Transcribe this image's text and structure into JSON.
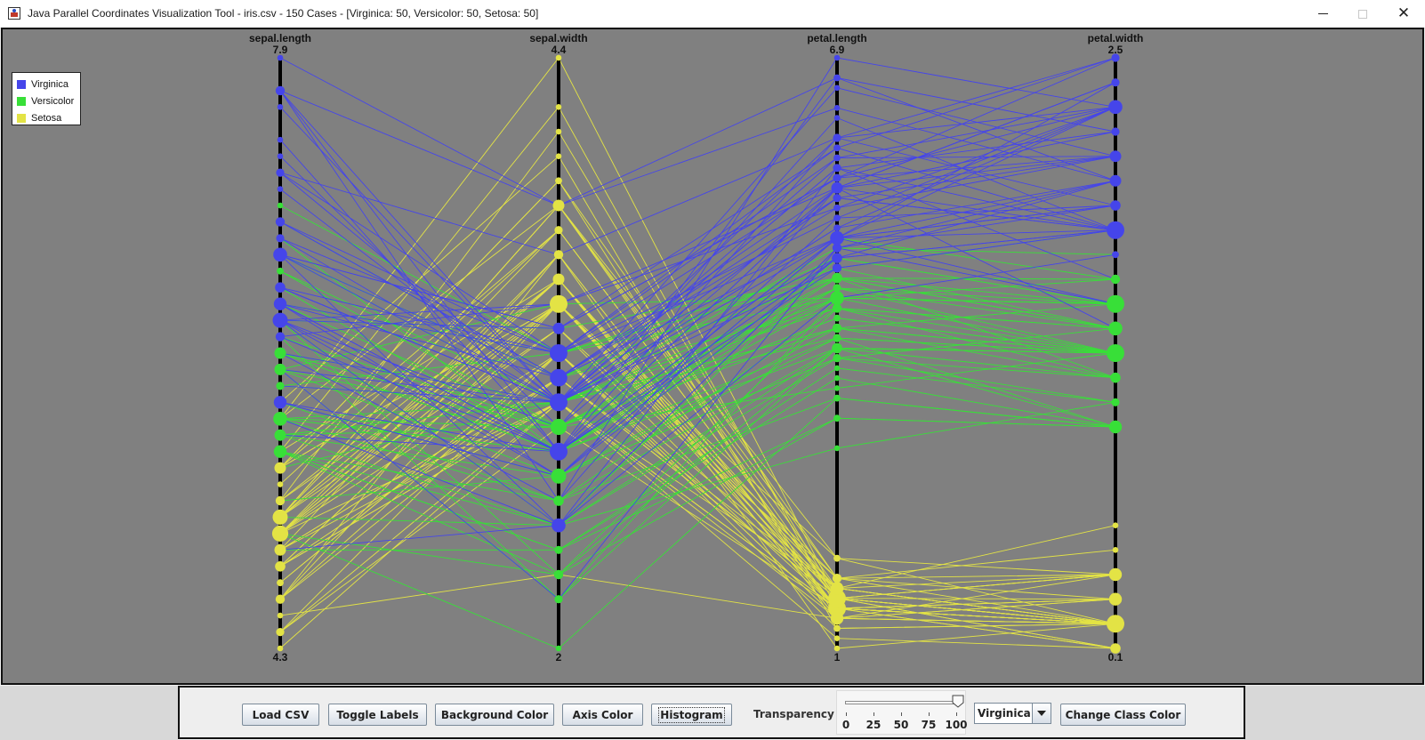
{
  "window": {
    "title": "Java Parallel Coordinates Visualization Tool - iris.csv - 150 Cases - [Virginica: 50, Versicolor: 50, Setosa: 50]"
  },
  "legend": {
    "items": [
      {
        "label": "Virginica",
        "color": "#4545ea"
      },
      {
        "label": "Versicolor",
        "color": "#38df38"
      },
      {
        "label": "Setosa",
        "color": "#e3e345"
      }
    ]
  },
  "controls": {
    "load_csv": "Load CSV",
    "toggle_labels": "Toggle Labels",
    "background_color": "Background Color",
    "axis_color": "Axis Color",
    "histogram": "Histogram",
    "transparency_label": "Transparency",
    "slider": {
      "value": 100,
      "ticks": [
        "0",
        "25",
        "50",
        "75",
        "100"
      ]
    },
    "class_select": "Virginica",
    "change_class_color": "Change Class Color"
  },
  "chart_data": {
    "type": "parallel-coordinates",
    "background": "#808080",
    "axes": [
      {
        "name": "sepal.length",
        "max": "7.9",
        "min": "4.3"
      },
      {
        "name": "sepal.width",
        "max": "4.4",
        "min": "2"
      },
      {
        "name": "petal.length",
        "max": "6.9",
        "min": "1"
      },
      {
        "name": "petal.width",
        "max": "2.5",
        "min": "0.1"
      }
    ],
    "classes": [
      {
        "name": "Virginica",
        "color": "#4545ea"
      },
      {
        "name": "Versicolor",
        "color": "#38df38"
      },
      {
        "name": "Setosa",
        "color": "#e3e345"
      }
    ],
    "rows": [
      [
        5.1,
        3.5,
        1.4,
        0.2,
        2
      ],
      [
        4.9,
        3.0,
        1.4,
        0.2,
        2
      ],
      [
        4.7,
        3.2,
        1.3,
        0.2,
        2
      ],
      [
        4.6,
        3.1,
        1.5,
        0.2,
        2
      ],
      [
        5.0,
        3.6,
        1.4,
        0.2,
        2
      ],
      [
        5.4,
        3.9,
        1.7,
        0.4,
        2
      ],
      [
        4.6,
        3.4,
        1.4,
        0.3,
        2
      ],
      [
        5.0,
        3.4,
        1.5,
        0.2,
        2
      ],
      [
        4.4,
        2.9,
        1.4,
        0.2,
        2
      ],
      [
        4.9,
        3.1,
        1.5,
        0.1,
        2
      ],
      [
        5.4,
        3.7,
        1.5,
        0.2,
        2
      ],
      [
        4.8,
        3.4,
        1.6,
        0.2,
        2
      ],
      [
        4.8,
        3.0,
        1.4,
        0.1,
        2
      ],
      [
        4.3,
        3.0,
        1.1,
        0.1,
        2
      ],
      [
        5.8,
        4.0,
        1.2,
        0.2,
        2
      ],
      [
        5.7,
        4.4,
        1.5,
        0.4,
        2
      ],
      [
        5.4,
        3.9,
        1.3,
        0.4,
        2
      ],
      [
        5.1,
        3.5,
        1.4,
        0.3,
        2
      ],
      [
        5.7,
        3.8,
        1.7,
        0.3,
        2
      ],
      [
        5.1,
        3.8,
        1.5,
        0.3,
        2
      ],
      [
        5.4,
        3.4,
        1.7,
        0.2,
        2
      ],
      [
        5.1,
        3.7,
        1.5,
        0.4,
        2
      ],
      [
        4.6,
        3.6,
        1.0,
        0.2,
        2
      ],
      [
        5.1,
        3.3,
        1.7,
        0.5,
        2
      ],
      [
        4.8,
        3.4,
        1.9,
        0.2,
        2
      ],
      [
        5.0,
        3.0,
        1.6,
        0.2,
        2
      ],
      [
        5.0,
        3.4,
        1.6,
        0.4,
        2
      ],
      [
        5.2,
        3.5,
        1.5,
        0.2,
        2
      ],
      [
        5.2,
        3.4,
        1.4,
        0.2,
        2
      ],
      [
        4.7,
        3.2,
        1.6,
        0.2,
        2
      ],
      [
        4.8,
        3.1,
        1.6,
        0.2,
        2
      ],
      [
        5.4,
        3.4,
        1.5,
        0.4,
        2
      ],
      [
        5.2,
        4.1,
        1.5,
        0.1,
        2
      ],
      [
        5.5,
        4.2,
        1.4,
        0.2,
        2
      ],
      [
        4.9,
        3.1,
        1.5,
        0.2,
        2
      ],
      [
        5.0,
        3.2,
        1.2,
        0.2,
        2
      ],
      [
        5.5,
        3.5,
        1.3,
        0.2,
        2
      ],
      [
        4.9,
        3.6,
        1.4,
        0.1,
        2
      ],
      [
        4.4,
        3.0,
        1.3,
        0.2,
        2
      ],
      [
        5.1,
        3.4,
        1.5,
        0.2,
        2
      ],
      [
        5.0,
        3.5,
        1.3,
        0.3,
        2
      ],
      [
        4.5,
        2.3,
        1.3,
        0.3,
        2
      ],
      [
        4.4,
        3.2,
        1.3,
        0.2,
        2
      ],
      [
        5.0,
        3.5,
        1.6,
        0.6,
        2
      ],
      [
        5.1,
        3.8,
        1.9,
        0.4,
        2
      ],
      [
        4.8,
        3.0,
        1.4,
        0.3,
        2
      ],
      [
        5.1,
        3.8,
        1.6,
        0.2,
        2
      ],
      [
        4.6,
        3.2,
        1.4,
        0.2,
        2
      ],
      [
        5.3,
        3.7,
        1.5,
        0.2,
        2
      ],
      [
        5.0,
        3.3,
        1.4,
        0.2,
        2
      ],
      [
        7.0,
        3.2,
        4.7,
        1.4,
        1
      ],
      [
        6.4,
        3.2,
        4.5,
        1.5,
        1
      ],
      [
        6.9,
        3.1,
        4.9,
        1.5,
        1
      ],
      [
        5.5,
        2.3,
        4.0,
        1.3,
        1
      ],
      [
        6.5,
        2.8,
        4.6,
        1.5,
        1
      ],
      [
        5.7,
        2.8,
        4.5,
        1.3,
        1
      ],
      [
        6.3,
        3.3,
        4.7,
        1.6,
        1
      ],
      [
        4.9,
        2.4,
        3.3,
        1.0,
        1
      ],
      [
        6.6,
        2.9,
        4.6,
        1.3,
        1
      ],
      [
        5.2,
        2.7,
        3.9,
        1.4,
        1
      ],
      [
        5.0,
        2.0,
        3.5,
        1.0,
        1
      ],
      [
        5.9,
        3.0,
        4.2,
        1.5,
        1
      ],
      [
        6.0,
        2.2,
        4.0,
        1.0,
        1
      ],
      [
        6.1,
        2.9,
        4.7,
        1.4,
        1
      ],
      [
        5.6,
        2.9,
        3.6,
        1.3,
        1
      ],
      [
        6.7,
        3.1,
        4.4,
        1.4,
        1
      ],
      [
        5.6,
        3.0,
        4.5,
        1.5,
        1
      ],
      [
        5.8,
        2.7,
        4.1,
        1.0,
        1
      ],
      [
        6.2,
        2.2,
        4.5,
        1.5,
        1
      ],
      [
        5.6,
        2.5,
        3.9,
        1.1,
        1
      ],
      [
        5.9,
        3.2,
        4.8,
        1.8,
        1
      ],
      [
        6.1,
        2.8,
        4.0,
        1.3,
        1
      ],
      [
        6.3,
        2.5,
        4.9,
        1.5,
        1
      ],
      [
        6.1,
        2.8,
        4.7,
        1.2,
        1
      ],
      [
        6.4,
        2.9,
        4.3,
        1.3,
        1
      ],
      [
        6.6,
        3.0,
        4.4,
        1.4,
        1
      ],
      [
        6.8,
        2.8,
        4.8,
        1.4,
        1
      ],
      [
        6.7,
        3.0,
        5.0,
        1.7,
        1
      ],
      [
        6.0,
        2.9,
        4.5,
        1.5,
        1
      ],
      [
        5.7,
        2.6,
        3.5,
        1.0,
        1
      ],
      [
        5.5,
        2.4,
        3.8,
        1.1,
        1
      ],
      [
        5.5,
        2.4,
        3.7,
        1.0,
        1
      ],
      [
        5.8,
        2.7,
        3.9,
        1.2,
        1
      ],
      [
        6.0,
        2.7,
        5.1,
        1.6,
        1
      ],
      [
        5.4,
        3.0,
        4.5,
        1.5,
        1
      ],
      [
        6.0,
        3.4,
        4.5,
        1.6,
        1
      ],
      [
        6.7,
        3.1,
        4.7,
        1.5,
        1
      ],
      [
        6.3,
        2.3,
        4.4,
        1.3,
        1
      ],
      [
        5.6,
        3.0,
        4.1,
        1.3,
        1
      ],
      [
        5.5,
        2.5,
        4.0,
        1.3,
        1
      ],
      [
        5.5,
        2.6,
        4.4,
        1.2,
        1
      ],
      [
        6.1,
        3.0,
        4.6,
        1.4,
        1
      ],
      [
        5.8,
        2.6,
        4.0,
        1.2,
        1
      ],
      [
        5.0,
        2.3,
        3.3,
        1.0,
        1
      ],
      [
        5.6,
        2.7,
        4.2,
        1.3,
        1
      ],
      [
        5.7,
        3.0,
        4.2,
        1.2,
        1
      ],
      [
        5.7,
        2.9,
        4.2,
        1.3,
        1
      ],
      [
        6.2,
        2.9,
        4.3,
        1.3,
        1
      ],
      [
        5.1,
        2.5,
        3.0,
        1.1,
        1
      ],
      [
        5.7,
        2.8,
        4.1,
        1.3,
        1
      ],
      [
        6.3,
        3.3,
        6.0,
        2.5,
        0
      ],
      [
        5.8,
        2.7,
        5.1,
        1.9,
        0
      ],
      [
        7.1,
        3.0,
        5.9,
        2.1,
        0
      ],
      [
        6.3,
        2.9,
        5.6,
        1.8,
        0
      ],
      [
        6.5,
        3.0,
        5.8,
        2.2,
        0
      ],
      [
        7.6,
        3.0,
        6.6,
        2.1,
        0
      ],
      [
        4.9,
        2.5,
        4.5,
        1.7,
        0
      ],
      [
        7.3,
        2.9,
        6.3,
        1.8,
        0
      ],
      [
        6.7,
        2.5,
        5.8,
        1.8,
        0
      ],
      [
        7.2,
        3.6,
        6.1,
        2.5,
        0
      ],
      [
        6.5,
        3.2,
        5.1,
        2.0,
        0
      ],
      [
        6.4,
        2.7,
        5.3,
        1.9,
        0
      ],
      [
        6.8,
        3.0,
        5.5,
        2.1,
        0
      ],
      [
        5.7,
        2.5,
        5.0,
        2.0,
        0
      ],
      [
        5.8,
        2.8,
        5.1,
        2.4,
        0
      ],
      [
        6.4,
        3.2,
        5.3,
        2.3,
        0
      ],
      [
        6.5,
        3.0,
        5.5,
        1.8,
        0
      ],
      [
        7.7,
        3.8,
        6.7,
        2.2,
        0
      ],
      [
        7.7,
        2.6,
        6.9,
        2.3,
        0
      ],
      [
        6.0,
        2.2,
        5.0,
        1.5,
        0
      ],
      [
        6.9,
        3.2,
        5.7,
        2.3,
        0
      ],
      [
        5.6,
        2.8,
        4.9,
        2.0,
        0
      ],
      [
        7.7,
        2.8,
        6.7,
        2.0,
        0
      ],
      [
        6.3,
        2.7,
        4.9,
        1.8,
        0
      ],
      [
        6.7,
        3.3,
        5.7,
        2.1,
        0
      ],
      [
        7.2,
        3.2,
        6.0,
        1.8,
        0
      ],
      [
        6.2,
        2.8,
        4.8,
        1.8,
        0
      ],
      [
        6.1,
        3.0,
        4.9,
        1.8,
        0
      ],
      [
        6.4,
        2.8,
        5.6,
        2.1,
        0
      ],
      [
        7.2,
        3.0,
        5.8,
        1.6,
        0
      ],
      [
        7.4,
        2.8,
        6.1,
        1.9,
        0
      ],
      [
        7.9,
        3.8,
        6.4,
        2.0,
        0
      ],
      [
        6.4,
        2.8,
        5.6,
        2.2,
        0
      ],
      [
        6.3,
        2.8,
        5.1,
        1.5,
        0
      ],
      [
        6.1,
        2.6,
        5.6,
        1.4,
        0
      ],
      [
        7.7,
        3.0,
        6.1,
        2.3,
        0
      ],
      [
        6.3,
        3.4,
        5.6,
        2.4,
        0
      ],
      [
        6.4,
        3.1,
        5.5,
        1.8,
        0
      ],
      [
        6.0,
        3.0,
        4.8,
        1.8,
        0
      ],
      [
        6.9,
        3.1,
        5.4,
        2.1,
        0
      ],
      [
        6.7,
        3.1,
        5.6,
        2.4,
        0
      ],
      [
        6.9,
        3.1,
        5.1,
        2.3,
        0
      ],
      [
        5.8,
        2.7,
        5.1,
        1.9,
        0
      ],
      [
        6.8,
        3.2,
        5.9,
        2.3,
        0
      ],
      [
        6.7,
        3.3,
        5.7,
        2.5,
        0
      ],
      [
        6.7,
        3.0,
        5.2,
        2.3,
        0
      ],
      [
        6.3,
        2.5,
        5.0,
        1.9,
        0
      ],
      [
        6.5,
        3.0,
        5.2,
        2.0,
        0
      ],
      [
        6.2,
        3.4,
        5.4,
        2.3,
        0
      ],
      [
        5.9,
        3.0,
        5.1,
        1.8,
        0
      ]
    ]
  }
}
